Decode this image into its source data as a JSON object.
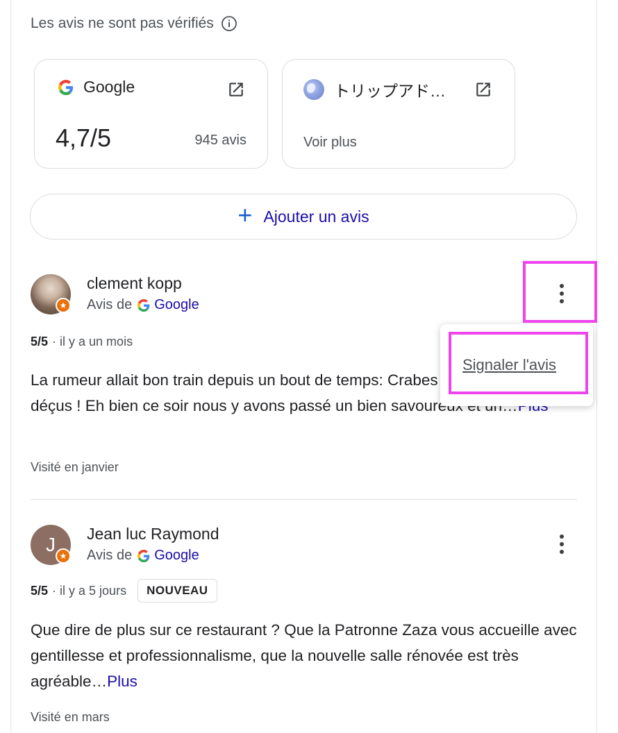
{
  "disclaimer": {
    "text": "Les avis ne sont pas vérifiés",
    "icon": "info-icon"
  },
  "sources": [
    {
      "name": "Google",
      "icon": "google-g-icon",
      "rating": "4,7/5",
      "count": "945 avis",
      "open_icon": "external-link-icon"
    },
    {
      "name": "トリップアド…",
      "icon": "tripadvisor-globe-icon",
      "more": "Voir plus",
      "open_icon": "external-link-icon"
    }
  ],
  "add_review": {
    "label": "Ajouter un avis",
    "icon": "plus-icon"
  },
  "reviews": [
    {
      "author": "clement kopp",
      "source_prefix": "Avis de",
      "source_name": "Google",
      "rating": "5/5",
      "time": "· il y a un mois",
      "text": "La rumeur allait bon train depuis un bout de temps: Crabes vous ne serez pas déçus ! Eh bien ce soir nous y avons passé un bien savoureux et un…",
      "more": "Plus",
      "visited": "Visité en janvier"
    },
    {
      "author": "Jean luc Raymond",
      "avatar_letter": "J",
      "source_prefix": "Avis de",
      "source_name": "Google",
      "rating": "5/5",
      "time": "· il y a 5 jours",
      "tag": "NOUVEAU",
      "text": "Que dire de plus sur ce restaurant ? Que la Patronne Zaza vous accueille avec gentillesse et professionnalisme, que la nouvelle salle rénovée est très agréable…",
      "more": "Plus",
      "visited": "Visité en mars"
    }
  ],
  "menu": {
    "report_label": "Signaler l'avis"
  },
  "colors": {
    "link": "#1a0dab",
    "highlight": "#ee44ee",
    "badge": "#e8710a"
  }
}
